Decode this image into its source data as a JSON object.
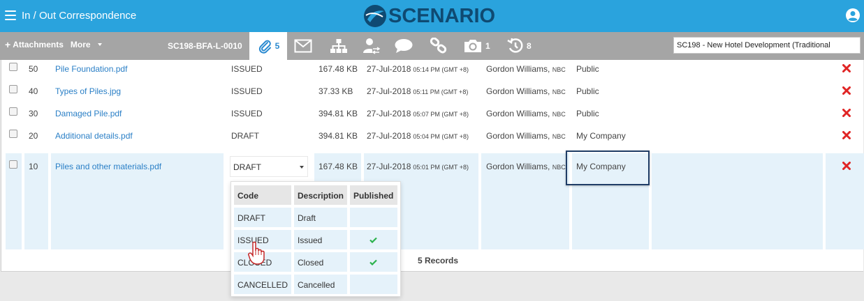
{
  "header": {
    "title": "In / Out Correspondence",
    "logo_text": "SCENARIO"
  },
  "toolbar": {
    "attachments_label": "Attachments",
    "more_label": "More",
    "reference": "SC198-BFA-L-0010",
    "attachments_count": "5",
    "photos_count": "1",
    "history_count": "8",
    "project": "SC198  -  New Hotel Development (Traditional"
  },
  "rows": [
    {
      "num": "50",
      "file": "Pile Foundation.pdf",
      "status": "ISSUED",
      "size": "167.48 KB",
      "date": "27-Jul-2018",
      "time": "05:14 PM (GMT +8)",
      "by": "Gordon Williams,",
      "org": "NBC",
      "access": "Public"
    },
    {
      "num": "40",
      "file": "Types of Piles.jpg",
      "status": "ISSUED",
      "size": "37.33 KB",
      "date": "27-Jul-2018",
      "time": "05:11 PM (GMT +8)",
      "by": "Gordon Williams,",
      "org": "NBC",
      "access": "Public"
    },
    {
      "num": "30",
      "file": "Damaged Pile.pdf",
      "status": "ISSUED",
      "size": "394.81 KB",
      "date": "27-Jul-2018",
      "time": "05:07 PM (GMT +8)",
      "by": "Gordon Williams,",
      "org": "NBC",
      "access": "Public"
    },
    {
      "num": "20",
      "file": "Additional details.pdf",
      "status": "DRAFT",
      "size": "394.81 KB",
      "date": "27-Jul-2018",
      "time": "05:04 PM (GMT +8)",
      "by": "Gordon Williams,",
      "org": "NBC",
      "access": "My Company"
    }
  ],
  "selected_row": {
    "num": "10",
    "file": "Piles and other materials.pdf",
    "status": "DRAFT",
    "size": "167.48 KB",
    "date": "27-Jul-2018",
    "time": "05:01 PM (GMT +8)",
    "by": "Gordon Williams,",
    "org": "NBC",
    "access": "My Company"
  },
  "records_label": "5  Records",
  "dropdown": {
    "headers": {
      "code": "Code",
      "description": "Description",
      "published": "Published"
    },
    "options": [
      {
        "code": "DRAFT",
        "description": "Draft",
        "published": false
      },
      {
        "code": "ISSUED",
        "description": "Issued",
        "published": true
      },
      {
        "code": "CLOSED",
        "description": "Closed",
        "published": true
      },
      {
        "code": "CANCELLED",
        "description": "Cancelled",
        "published": false
      }
    ]
  },
  "colors": {
    "header_bg": "#2aa3dd",
    "toolbar_bg": "#a5a5a5",
    "link": "#2a7fc6",
    "delete": "#e02424",
    "check": "#2bb24c",
    "selected_bg": "#e5f2fa"
  }
}
